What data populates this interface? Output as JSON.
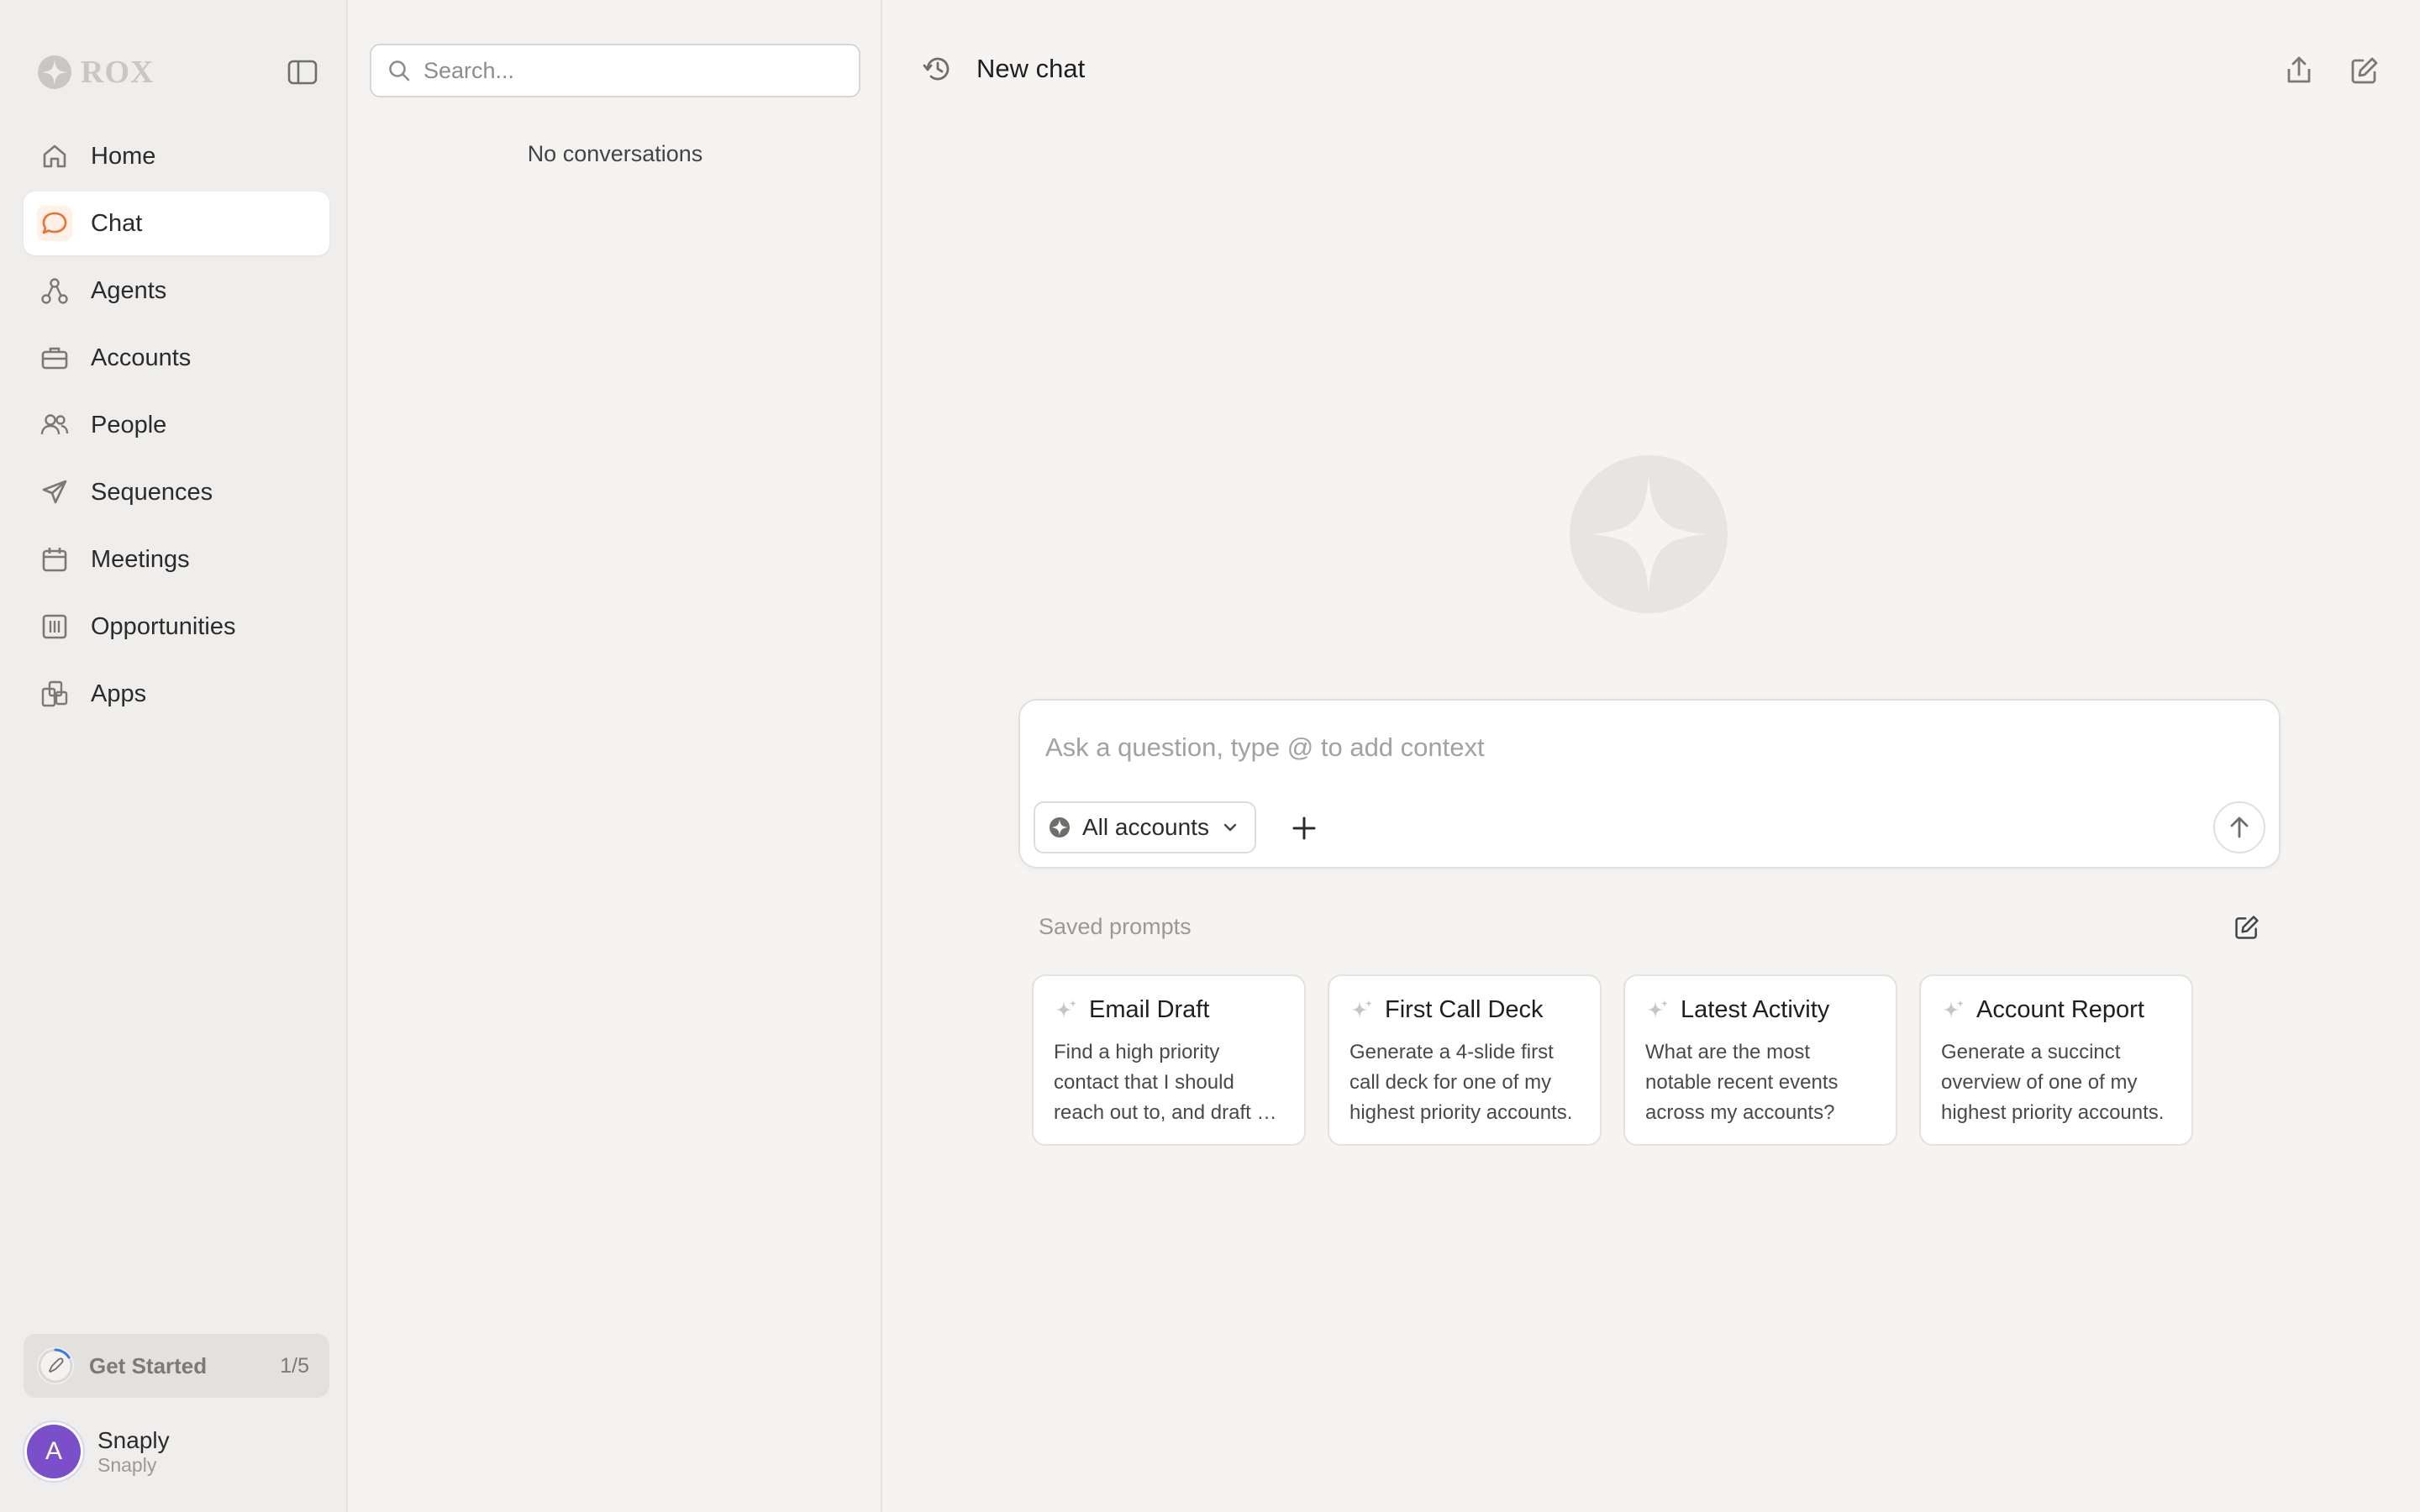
{
  "brand": {
    "name": "ROX"
  },
  "nav": {
    "items": [
      {
        "label": "Home",
        "icon": "home-icon"
      },
      {
        "label": "Chat",
        "icon": "chat-bubble-icon",
        "active": true
      },
      {
        "label": "Agents",
        "icon": "agents-icon"
      },
      {
        "label": "Accounts",
        "icon": "briefcase-icon"
      },
      {
        "label": "People",
        "icon": "people-icon"
      },
      {
        "label": "Sequences",
        "icon": "send-icon"
      },
      {
        "label": "Meetings",
        "icon": "calendar-icon"
      },
      {
        "label": "Opportunities",
        "icon": "columns-icon"
      },
      {
        "label": "Apps",
        "icon": "apps-icon"
      }
    ]
  },
  "get_started": {
    "label": "Get Started",
    "count": "1/5"
  },
  "user": {
    "initial": "A",
    "name": "Snaply",
    "org": "Snaply"
  },
  "conversations": {
    "search_placeholder": "Search...",
    "empty_text": "No conversations"
  },
  "main": {
    "title": "New chat",
    "composer": {
      "placeholder": "Ask a question, type @ to add context",
      "account_filter": "All accounts"
    },
    "saved_prompts": {
      "heading": "Saved prompts",
      "items": [
        {
          "title": "Email Draft",
          "desc": "Find a high priority contact that I should reach out to, and draft an email to them."
        },
        {
          "title": "First Call Deck",
          "desc": "Generate a 4-slide first call deck for one of my highest priority accounts."
        },
        {
          "title": "Latest Activity",
          "desc": "What are the most notable recent events across my accounts?"
        },
        {
          "title": "Account Report",
          "desc": "Generate a succinct overview of one of my highest priority accounts."
        }
      ]
    }
  },
  "colors": {
    "accent": "#e8742f",
    "avatar": "#7a4fc9",
    "background": "#f5f4f2"
  }
}
